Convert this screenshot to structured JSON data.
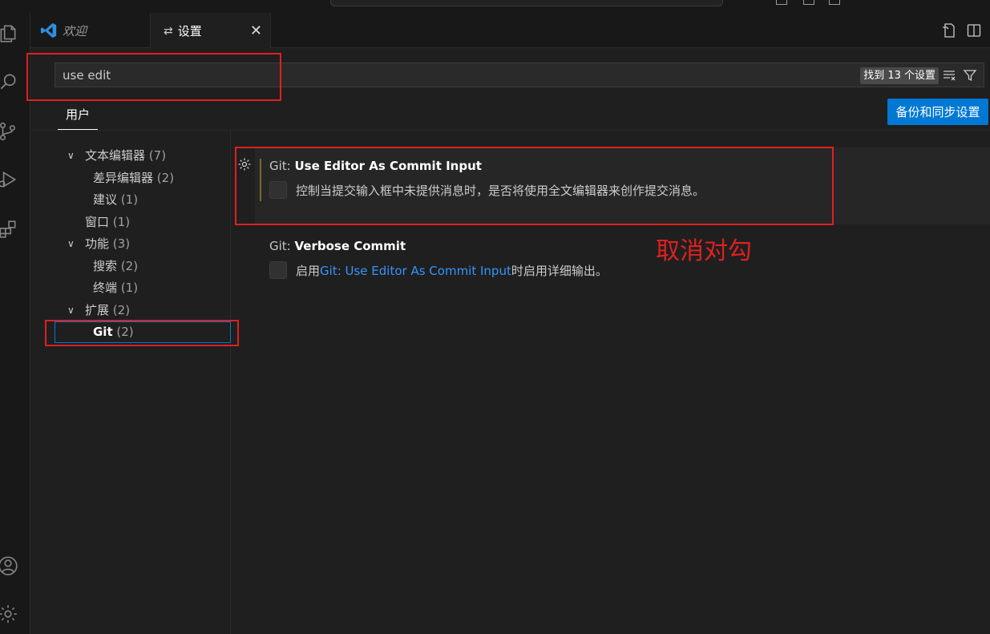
{
  "tabs": {
    "welcome_label": "欢迎",
    "settings_label": "设置",
    "close_glyph": "✕",
    "settings_glyph": "⇄"
  },
  "search": {
    "value": "use edit",
    "result_count": "找到 13 个设置"
  },
  "scope": {
    "user_tab": "用户",
    "sync_button": "备份和同步设置"
  },
  "toc": [
    {
      "label": "文本编辑器",
      "count": "(7)",
      "expanded": true
    },
    {
      "label": "差异编辑器",
      "count": "(2)"
    },
    {
      "label": "建议",
      "count": "(1)"
    },
    {
      "label": "窗口",
      "count": "(1)"
    },
    {
      "label": "功能",
      "count": "(3)",
      "expanded": true
    },
    {
      "label": "搜索",
      "count": "(2)"
    },
    {
      "label": "终端",
      "count": "(1)"
    },
    {
      "label": "扩展",
      "count": "(2)",
      "expanded": true
    },
    {
      "label": "Git",
      "count": "(2)",
      "selected": true
    }
  ],
  "settings": [
    {
      "category": "Git: ",
      "title": "Use Editor As Commit Input",
      "description": "控制当提交输入框中未提供消息时，是否将使用全文编辑器来创作提交消息。",
      "checked": false
    },
    {
      "category": "Git: ",
      "title": "Verbose Commit",
      "description_prefix": "启用",
      "description_link": "Git: Use Editor As Commit Input",
      "description_suffix": "时启用详细输出。",
      "checked": false
    }
  ],
  "annotation": {
    "text": "取消对勾",
    "color": "#e02020"
  },
  "colors": {
    "accent": "#0078d4",
    "link": "#3794ff",
    "background": "#1f1f1f",
    "modified_bar": "#7a6b2e"
  },
  "icons": [
    "explorer-icon",
    "search-icon",
    "source-control-icon",
    "run-debug-icon",
    "extensions-icon",
    "account-icon",
    "manage-gear-icon",
    "vscode-logo-icon",
    "open-settings-json-icon",
    "split-editor-icon",
    "clear-filter-icon",
    "filter-icon",
    "setting-gear-icon"
  ]
}
